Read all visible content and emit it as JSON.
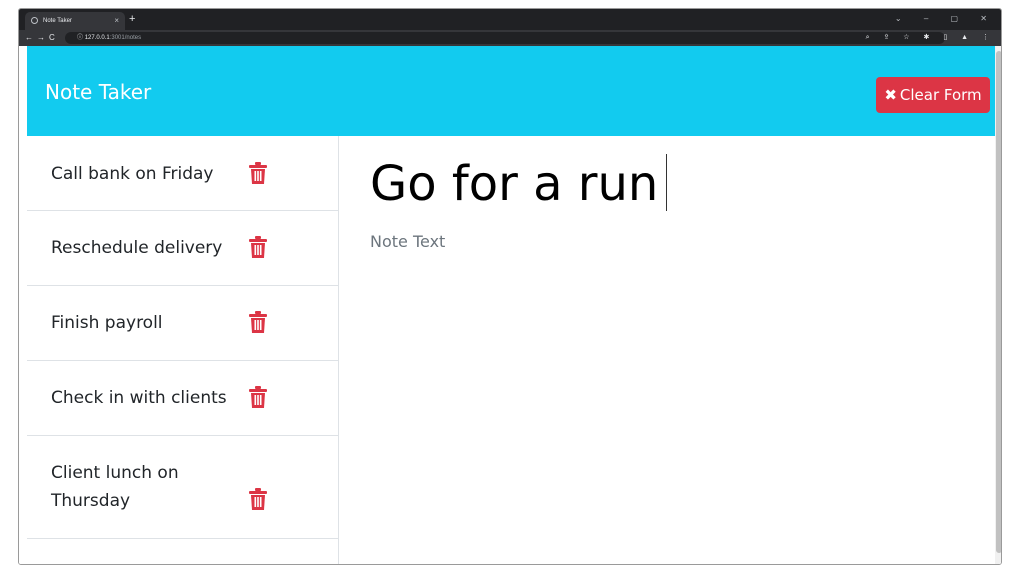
{
  "browser": {
    "tab_title": "Note Taker",
    "tab_close": "×",
    "new_tab": "+",
    "window_controls": "⌄ – ▢ ✕",
    "nav": {
      "back": "←",
      "forward": "→",
      "reload": "C"
    },
    "url_info_icon": "ⓘ",
    "url_host": "127.0.0.1",
    "url_path": ":3001/notes",
    "extension_icons": "⌕ ⇪ ☆ ✱ ▯ ▲ ⋮"
  },
  "app": {
    "brand": "Note Taker",
    "clear_button": {
      "icon": "✖",
      "label": "Clear Form"
    },
    "accent_color": "#12cbef",
    "danger_color": "#dc3545"
  },
  "notes": [
    {
      "title": "Call bank on Friday"
    },
    {
      "title": "Reschedule delivery"
    },
    {
      "title": "Finish payroll"
    },
    {
      "title": "Check in with clients"
    },
    {
      "title": "Client lunch on Thursday"
    }
  ],
  "editor": {
    "title_value": "Go for a run",
    "text_placeholder": "Note Text",
    "text_value": ""
  }
}
